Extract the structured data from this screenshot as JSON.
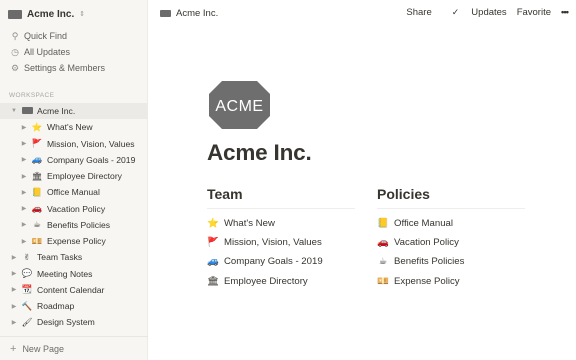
{
  "sidebar": {
    "workspace_name": "Acme Inc.",
    "menu": [
      {
        "icon": "search-icon",
        "glyph": "⚲",
        "label": "Quick Find"
      },
      {
        "icon": "clock-icon",
        "glyph": "◷",
        "label": "All Updates"
      },
      {
        "icon": "gear-icon",
        "glyph": "⚙",
        "label": "Settings & Members"
      }
    ],
    "section_label": "WORKSPACE",
    "pages": [
      {
        "label": "Acme Inc.",
        "icon": "acme-logo-icon",
        "glyph": "",
        "expanded": true
      },
      {
        "label": "What's New",
        "icon": "star-icon",
        "glyph": "⭐"
      },
      {
        "label": "Mission, Vision, Values",
        "icon": "flag-icon",
        "glyph": "🚩"
      },
      {
        "label": "Company Goals - 2019",
        "icon": "bus-icon",
        "glyph": "🚙"
      },
      {
        "label": "Employee Directory",
        "icon": "building-icon",
        "glyph": "🏛"
      },
      {
        "label": "Office Manual",
        "icon": "scroll-icon",
        "glyph": "📒"
      },
      {
        "label": "Vacation Policy",
        "icon": "car-icon",
        "glyph": "🚗"
      },
      {
        "label": "Benefits Policies",
        "icon": "coffee-icon",
        "glyph": "☕"
      },
      {
        "label": "Expense Policy",
        "icon": "money-icon",
        "glyph": "💴"
      },
      {
        "label": "Team Tasks",
        "icon": "hand-icon",
        "glyph": "✌"
      },
      {
        "label": "Meeting Notes",
        "icon": "speech-bubble-icon",
        "glyph": "💬"
      },
      {
        "label": "Content Calendar",
        "icon": "calendar-icon",
        "glyph": "📆"
      },
      {
        "label": "Roadmap",
        "icon": "hammer-icon",
        "glyph": "🔨"
      },
      {
        "label": "Design System",
        "icon": "paintbrush-icon",
        "glyph": "🖌"
      }
    ],
    "new_page": "New Page"
  },
  "topbar": {
    "breadcrumb": "Acme Inc.",
    "share": "Share",
    "updates": "Updates",
    "favorite": "Favorite",
    "more": "•••"
  },
  "page": {
    "logo_text": "ACME",
    "title": "Acme Inc.",
    "team": {
      "heading": "Team",
      "links": [
        {
          "label": "What's New",
          "glyph": "⭐"
        },
        {
          "label": "Mission, Vision, Values",
          "glyph": "🚩"
        },
        {
          "label": "Company Goals - 2019",
          "glyph": "🚙"
        },
        {
          "label": "Employee Directory",
          "glyph": "🏛"
        }
      ]
    },
    "policies": {
      "heading": "Policies",
      "links": [
        {
          "label": "Office Manual",
          "glyph": "📒"
        },
        {
          "label": "Vacation Policy",
          "glyph": "🚗"
        },
        {
          "label": "Benefits Policies",
          "glyph": "☕"
        },
        {
          "label": "Expense Policy",
          "glyph": "💴"
        }
      ]
    }
  },
  "colors": {
    "sidebar_bg": "#f7f6f3",
    "text": "#37352f",
    "logo_fill": "#6b6b6b"
  }
}
